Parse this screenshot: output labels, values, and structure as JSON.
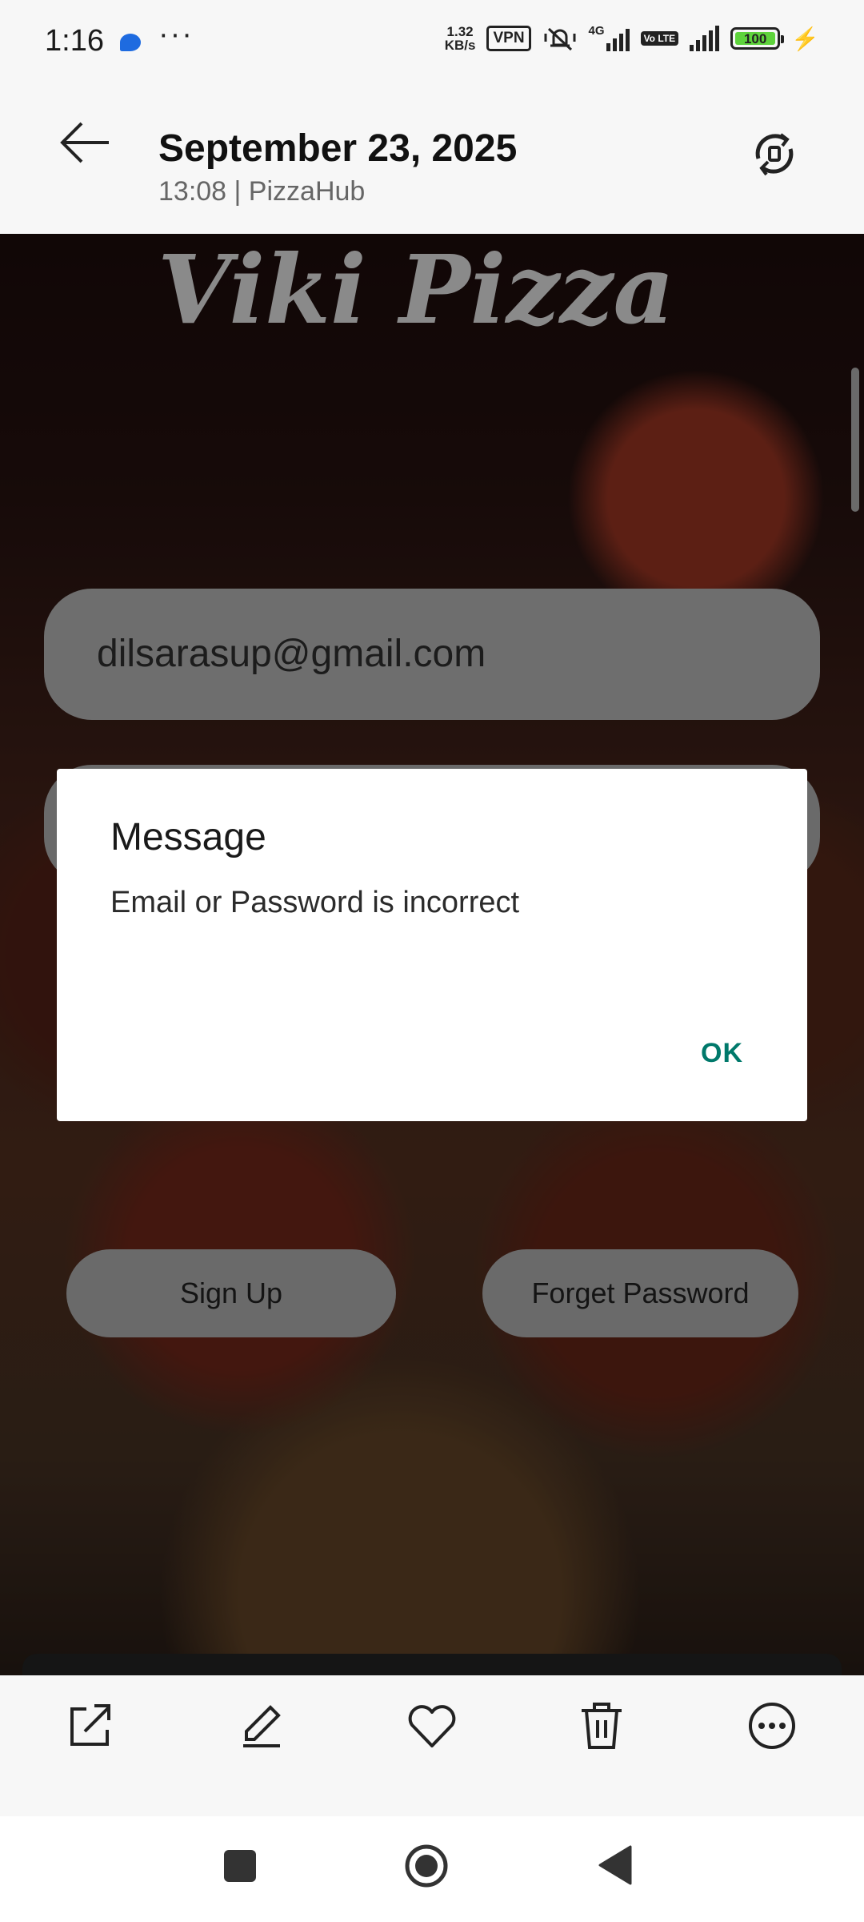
{
  "status_bar": {
    "time": "1:16",
    "more": "···",
    "net_speed_value": "1.32",
    "net_speed_unit": "KB/s",
    "vpn_label": "VPN",
    "network_label": "4G",
    "volte_label": "Vo LTE",
    "battery_level": "100"
  },
  "header": {
    "title": "September 23, 2025",
    "subtitle": "13:08 | PizzaHub"
  },
  "app": {
    "title": "Viki Pizza",
    "email_value": "dilsarasup@gmail.com",
    "signup_label": "Sign Up",
    "forget_label": "Forget Password"
  },
  "dialog": {
    "title": "Message",
    "message": "Email or Password is incorrect",
    "ok_label": "OK"
  },
  "actions": [
    "share-icon",
    "edit-icon",
    "favorite-icon",
    "delete-icon",
    "more-icon"
  ],
  "colors": {
    "accent": "#00796b",
    "battery": "#5ed33c",
    "message_dot": "#1e6be0"
  }
}
